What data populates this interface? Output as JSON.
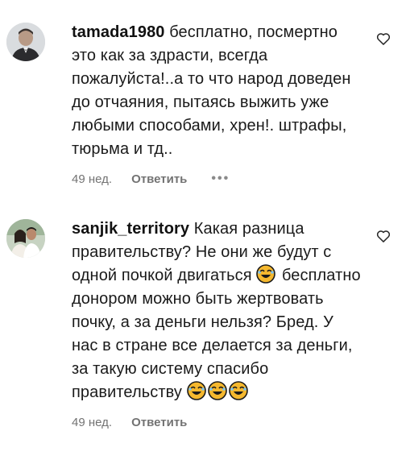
{
  "comments": [
    {
      "username": "tamada1980",
      "text": " бесплатно, посмертно это как за здрасти, всегда пожалуйста!..а то что народ доведен до отчаяния, пытаясь выжить уже любыми способами, хрен!. штрафы, тюрьма и тд..",
      "age": "49 нед.",
      "reply_label": "Ответить",
      "more_label": "•••",
      "avatar_icon": "avatar-photo-man-suit",
      "like_icon": "heart-outline-icon"
    },
    {
      "username": "sanjik_territory",
      "text_part1": " Какая разница правительству? Не они же будут с одной почкой двигаться ",
      "text_part2": " бесплатно донором можно быть жертвовать почку, а за деньги нельзя? Бред. У нас в стране все делается за деньги, за такую систему спасибо правительству ",
      "emoji_inline": "rolling-on-floor-laughing",
      "emoji_trailing": [
        "rolling-on-floor-laughing",
        "rolling-on-floor-laughing",
        "rolling-on-floor-laughing"
      ],
      "age": "49 нед.",
      "reply_label": "Ответить",
      "avatar_icon": "avatar-photo-couple",
      "like_icon": "heart-outline-icon"
    }
  ],
  "colors": {
    "text": "#1a1a1a",
    "meta": "#737373",
    "background": "#ffffff",
    "emoji": "#f5b82e"
  }
}
